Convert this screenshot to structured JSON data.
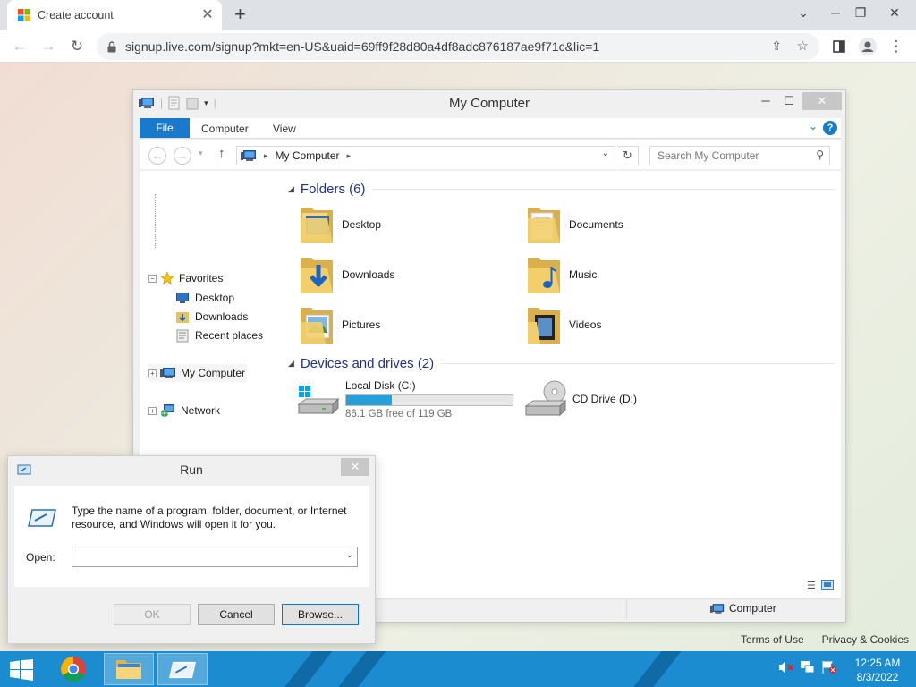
{
  "browser": {
    "tab_title": "Create account",
    "tab_close": "✕",
    "new_tab": "+",
    "url": "signup.live.com/signup?mkt=en-US&uaid=69ff9f28d80a4df8adc876187ae9f71c&lic=1",
    "window_controls": [
      "⌄",
      "─",
      "❐",
      "✕"
    ]
  },
  "page": {
    "footer_links": [
      "Terms of Use",
      "Privacy & Cookies"
    ]
  },
  "explorer": {
    "title": "My Computer",
    "ribbon_tabs": [
      "File",
      "Computer",
      "View"
    ],
    "address": "My Computer",
    "search_placeholder": "Search My Computer",
    "nav_tree": {
      "favorites": "Favorites",
      "favorites_items": [
        "Desktop",
        "Downloads",
        "Recent places"
      ],
      "my_computer": "My Computer",
      "network": "Network"
    },
    "folders_header": "Folders (6)",
    "folders": [
      "Desktop",
      "Documents",
      "Downloads",
      "Music",
      "Pictures",
      "Videos"
    ],
    "devices_header": "Devices and drives (2)",
    "drives": [
      {
        "name": "Local Disk (C:)",
        "free_text": "86.1 GB free of 119 GB",
        "used_fraction": 0.276
      },
      {
        "name": "CD Drive (D:)"
      }
    ],
    "status_location": "Computer"
  },
  "run_dialog": {
    "title": "Run",
    "description": "Type the name of a program, folder, document, or Internet resource, and Windows will open it for you.",
    "open_label": "Open:",
    "open_value": "",
    "ok_label": "OK",
    "cancel_label": "Cancel",
    "browse_label": "Browse..."
  },
  "taskbar": {
    "time": "12:25 AM",
    "date": "8/3/2022"
  },
  "colors": {
    "taskbar": "#1a8ccf",
    "accent": "#1979ca",
    "progress": "#26a0da"
  }
}
